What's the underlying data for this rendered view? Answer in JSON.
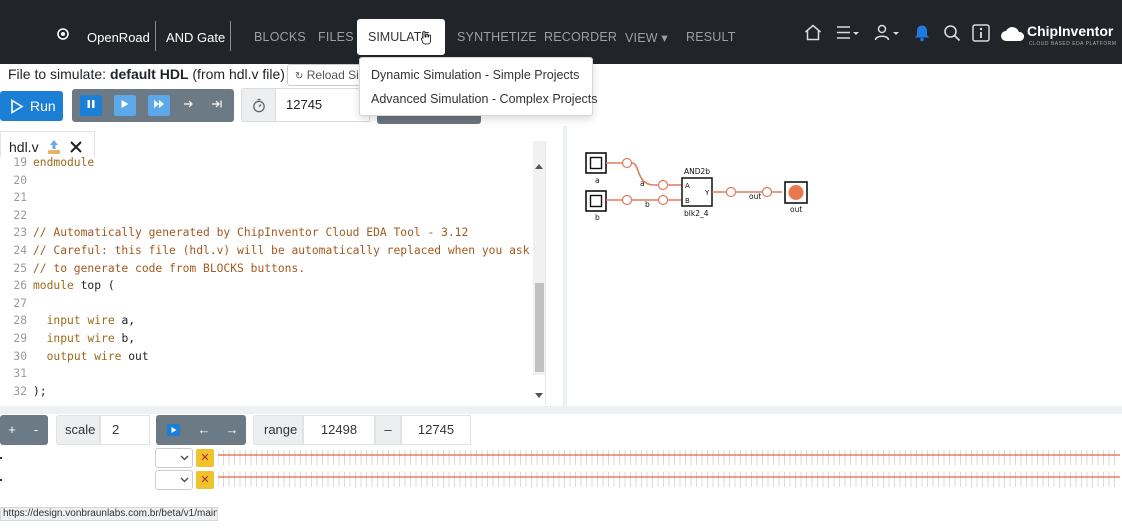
{
  "topbar": {
    "project": "OpenRoad",
    "design": "AND Gate",
    "nav": [
      "BLOCKS",
      "FILES",
      "SIMULATE",
      "SYNTHETIZE",
      "RECORDER",
      "VIEW ▾",
      "RESULT"
    ],
    "active_tab": "SIMULATE",
    "logo_text": "ChipInventor",
    "logo_tagline": "CLOUD BASED EDA PLATFORM",
    "icons": [
      "home-icon",
      "menu-icon",
      "user-icon",
      "bell-icon",
      "search-icon",
      "info-icon"
    ]
  },
  "simulate_menu": [
    "Dynamic Simulation - Simple Projects",
    "Advanced Simulation - Complex Projects"
  ],
  "file_bar": {
    "prefix": "File to simulate:",
    "file": "default HDL",
    "suffix": "(from hdl.v file)",
    "reload_label": "Reload Si"
  },
  "toolbar": {
    "run_label": "Run",
    "time_value": "12745"
  },
  "editor": {
    "tab_name": "hdl.v",
    "lines": [
      {
        "n": "19",
        "text": "endmodule",
        "cls": "kw"
      },
      {
        "n": "20",
        "text": "",
        "cls": ""
      },
      {
        "n": "21",
        "text": "",
        "cls": ""
      },
      {
        "n": "22",
        "text": "",
        "cls": ""
      },
      {
        "n": "23",
        "text": "// Automatically generated by ChipInventor Cloud EDA Tool - 3.12",
        "cls": "cmt"
      },
      {
        "n": "24",
        "text": "// Careful: this file (hdl.v) will be automatically replaced when you ask",
        "cls": "cmt"
      },
      {
        "n": "25",
        "text": "// to generate code from BLOCKS buttons.",
        "cls": "cmt"
      },
      {
        "n": "26",
        "text": "module top (",
        "cls": ""
      },
      {
        "n": "27",
        "text": "",
        "cls": ""
      },
      {
        "n": "28",
        "text": "  input wire a,",
        "cls": ""
      },
      {
        "n": "29",
        "text": "  input wire b,",
        "cls": ""
      },
      {
        "n": "30",
        "text": "  output wire out",
        "cls": ""
      },
      {
        "n": "31",
        "text": "",
        "cls": ""
      },
      {
        "n": "32",
        "text": ");",
        "cls": ""
      }
    ]
  },
  "diagram": {
    "input_a": "a",
    "input_b": "b",
    "wire_a": "a",
    "wire_b": "b",
    "gate_type": "AND2b",
    "gate_pin_a": "A",
    "gate_pin_b": "B",
    "gate_pin_y": "Y",
    "gate_instance": "blk2_4",
    "wire_out": "out",
    "output": "out"
  },
  "bottom": {
    "plus": "+",
    "minus": "-",
    "scale_label": "scale",
    "scale_value": "2",
    "left_arrow": "←",
    "right_arrow": "→",
    "range_label": "range",
    "range_start": "12498",
    "range_dash": "–",
    "range_end": "12745"
  },
  "status_url": "https://design.vonbraunlabs.com.br/beta/v1/main.php#",
  "colors": {
    "topbar": "#212529",
    "accent": "#1b7fd6",
    "wire": "#e07a5f",
    "waveform": "#e8604c"
  }
}
